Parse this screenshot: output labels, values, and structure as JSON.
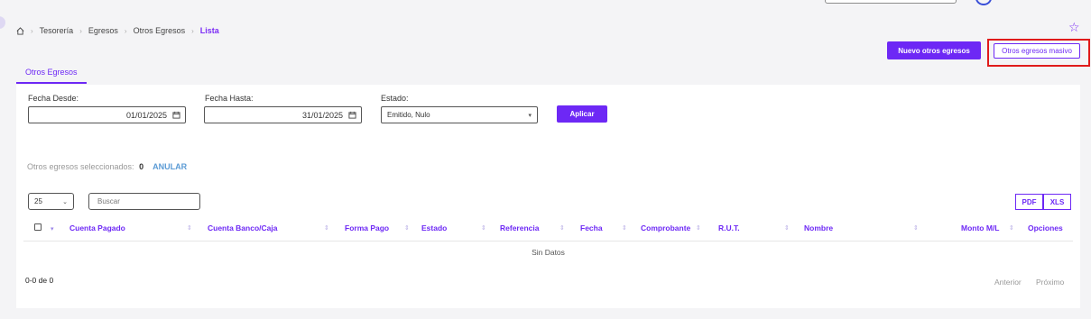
{
  "breadcrumb": {
    "items": [
      "Tesorería",
      "Egresos",
      "Otros Egresos"
    ],
    "current": "Lista"
  },
  "actions": {
    "new_label": "Nuevo otros egresos",
    "bulk_label": "Otros egresos masivo"
  },
  "tabs": [
    {
      "label": "Otros Egresos"
    }
  ],
  "filters": {
    "date_from_label": "Fecha Desde:",
    "date_from_value": "01/01/2025",
    "date_to_label": "Fecha Hasta:",
    "date_to_value": "31/01/2025",
    "status_label": "Estado:",
    "status_value": "Emitido, Nulo",
    "apply_label": "Aplicar"
  },
  "selection": {
    "label": "Otros egresos seleccionados:",
    "count": "0",
    "cancel_label": "ANULAR"
  },
  "table_controls": {
    "page_size": "25",
    "search_placeholder": "Buscar",
    "pdf_label": "PDF",
    "xls_label": "XLS"
  },
  "table": {
    "columns": [
      "Cuenta Pagado",
      "Cuenta Banco/Caja",
      "Forma Pago",
      "Estado",
      "Referencia",
      "Fecha",
      "Comprobante",
      "R.U.T.",
      "Nombre",
      "Monto M/L",
      "Opciones"
    ],
    "empty_text": "Sin Datos"
  },
  "pagination": {
    "range": "0-0 de 0",
    "prev_label": "Anterior",
    "next_label": "Próximo"
  },
  "colors": {
    "accent": "#6d28f5",
    "highlight": "#e01b1b",
    "link": "#5b9bd5"
  }
}
